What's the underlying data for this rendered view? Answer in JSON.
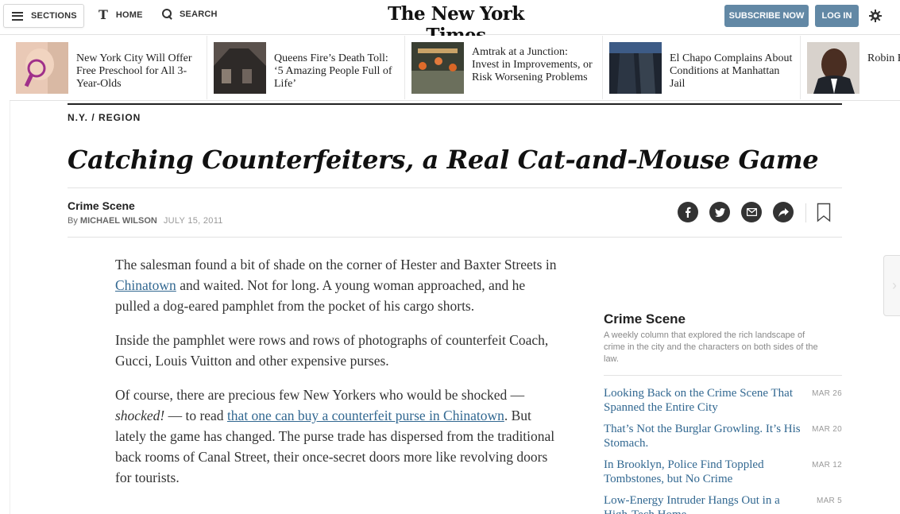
{
  "topbar": {
    "sections_label": "SECTIONS",
    "home_label": "HOME",
    "search_label": "SEARCH",
    "logo": "The New York Times",
    "subscribe_label": "SUBSCRIBE NOW",
    "login_label": "LOG IN",
    "accent_color": "#6288a5"
  },
  "ribbon": [
    {
      "headline": "New York City Will Offer Free Preschool for All 3-Year-Olds",
      "thumb_icon": "child-photo"
    },
    {
      "headline": "Queens Fire’s Death Toll: ‘5 Amazing People Full of Life’",
      "thumb_icon": "burned-house-photo"
    },
    {
      "headline": "Amtrak at a Junction: Invest in Improvements, or Risk Worsening Problems",
      "thumb_icon": "rail-workers-photo"
    },
    {
      "headline": "El Chapo Complains About Conditions at Manhattan Jail",
      "thumb_icon": "jail-building-photo"
    },
    {
      "headline": "Robin H Charity Gets Ne",
      "thumb_icon": "man-portrait-photo"
    }
  ],
  "article": {
    "kicker": "N.Y. / REGION",
    "headline": "Catching Counterfeiters, a Real Cat-and-Mouse Game",
    "column": "Crime Scene",
    "byline_prefix": "By ",
    "author": "MICHAEL WILSON",
    "date": "JULY 15, 2011",
    "share_icons": [
      "facebook-icon",
      "twitter-icon",
      "email-icon",
      "share-icon",
      "bookmark-icon"
    ],
    "p1_a": "The salesman found a bit of shade on the corner of Hester and Baxter Streets in ",
    "p1_link": "Chinatown",
    "p1_b": " and waited. Not for long. A young woman approached, and he pulled a dog-eared pamphlet from the pocket of his cargo shorts.",
    "p2": "Inside the pamphlet were rows and rows of photographs of counterfeit Coach, Gucci, Louis Vuitton and other expensive purses.",
    "p3_a": "Of course, there are precious few New Yorkers who would be shocked — ",
    "p3_em": "shocked!",
    "p3_b": " — to read ",
    "p3_link": "that one can buy a counterfeit purse in Chinatown",
    "p3_c": ". But lately the game has changed. The purse trade has dispersed from the traditional back rooms of Canal Street, their once-secret doors more like revolving doors for tourists.",
    "link_color": "#326891"
  },
  "sidebar": {
    "title": "Crime Scene",
    "description": "A weekly column that explored the rich landscape of crime in the city and the characters on both sides of the law.",
    "items": [
      {
        "title": "Looking Back on the Crime Scene That Spanned the Entire City",
        "date": "MAR 26"
      },
      {
        "title": "That’s Not the Burglar Growling. It’s His Stomach.",
        "date": "MAR 20"
      },
      {
        "title": "In Brooklyn, Police Find Toppled Tombstones, but No Crime",
        "date": "MAR 12"
      },
      {
        "title": "Low-Energy Intruder Hangs Out in a High-Tech Home",
        "date": "MAR 5"
      }
    ]
  }
}
